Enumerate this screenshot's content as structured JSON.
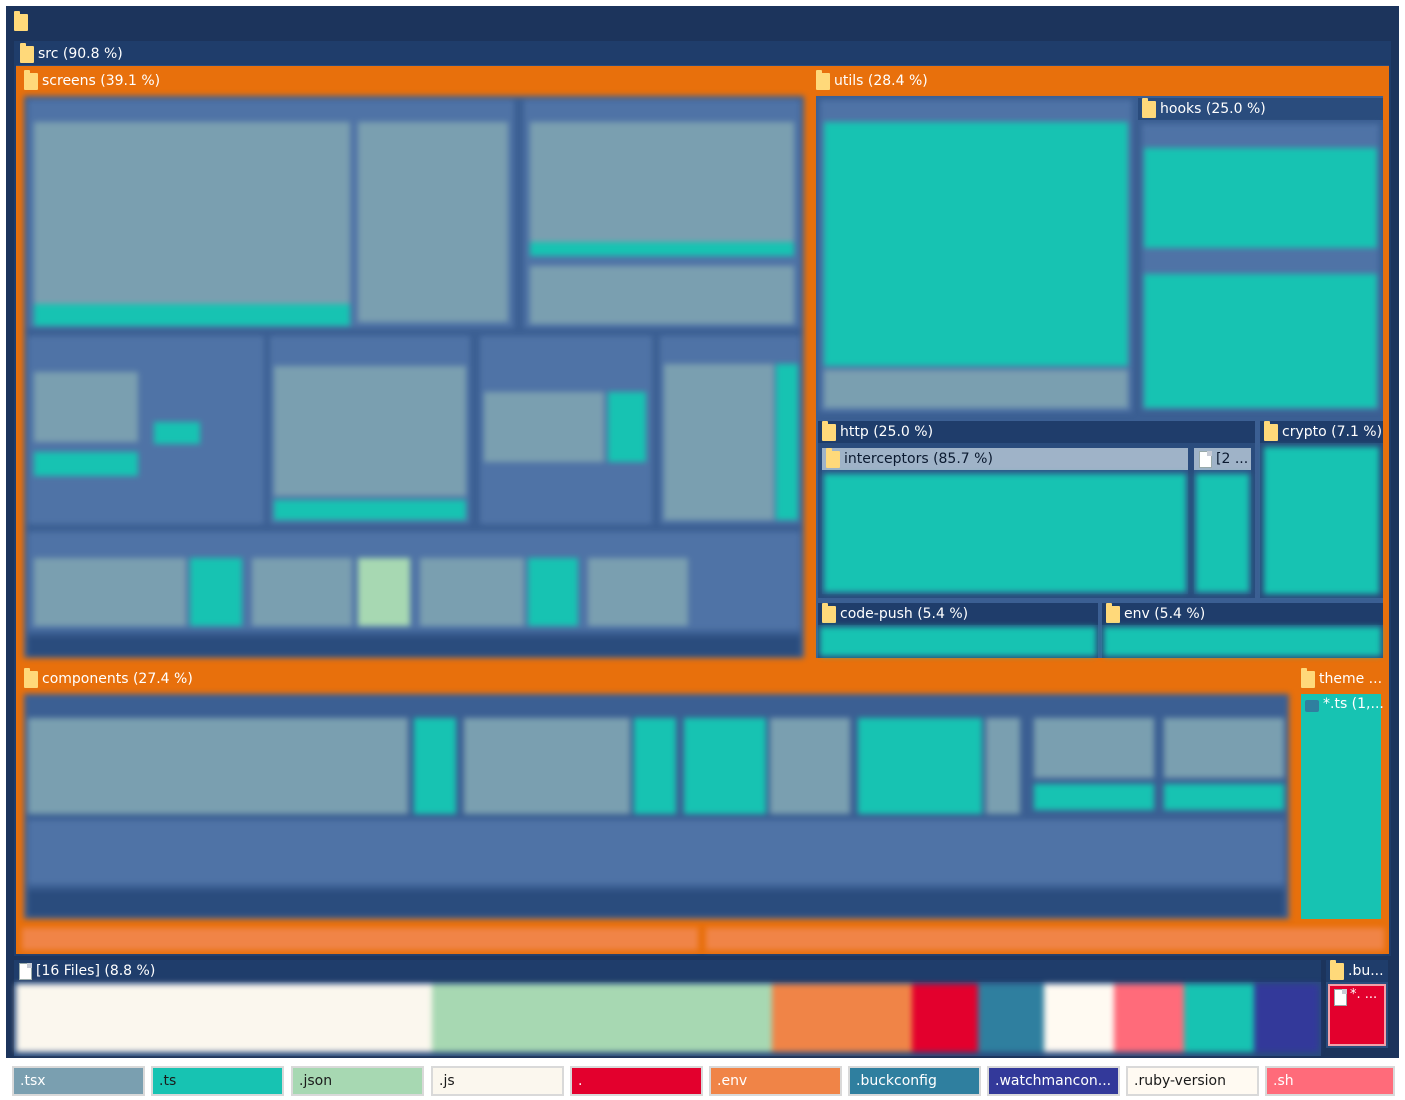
{
  "colors": {
    "root_bg": "#1c345c",
    "folder_bar": "#1f3d6b",
    "highlight": "#e8700c",
    "tsx": "#7a9fb0",
    "ts": "#17c3b2",
    "json": "#a7d8b2",
    "js": "#fbf7ee",
    "dot": "#e3002d",
    "env": "#f08447",
    "buckconfig": "#2f7f9f",
    "watchman": "#33399a",
    "ruby_version": "#fffaf2",
    "sh": "#ff6b7a"
  },
  "tree": {
    "root_icon": "folder-icon",
    "src": {
      "label": "src (90.8 %)"
    },
    "screens": {
      "label": "screens (39.1 %)"
    },
    "utils": {
      "label": "utils (28.4 %)"
    },
    "hooks": {
      "label": "hooks (25.0 %)"
    },
    "http": {
      "label": "http (25.0 %)"
    },
    "interceptors": {
      "label": "interceptors (85.7 %)"
    },
    "interceptors_sibling": {
      "label": "[2 ..."
    },
    "crypto": {
      "label": "crypto (7.1 %)"
    },
    "code_push": {
      "label": "code-push (5.4 %)"
    },
    "env": {
      "label": "env (5.4 %)"
    },
    "components": {
      "label": "components (27.4 %)"
    },
    "theme": {
      "label": "theme ...",
      "child": "*.ts (1,..."
    },
    "files16": {
      "label": "[16 Files] (8.8 %)"
    },
    "bu": {
      "label": ".bu...",
      "child": "*. ..."
    }
  },
  "legend": [
    {
      "label": ".tsx",
      "color": "#7a9fb0",
      "text": "dark"
    },
    {
      "label": ".ts",
      "color": "#17c3b2",
      "text": "light"
    },
    {
      "label": ".json",
      "color": "#a7d8b2",
      "text": "light"
    },
    {
      "label": ".js",
      "color": "#fbf7ee",
      "text": "light"
    },
    {
      "label": ".",
      "color": "#e3002d",
      "text": "dark"
    },
    {
      "label": ".env",
      "color": "#f08447",
      "text": "dark"
    },
    {
      "label": ".buckconfig",
      "color": "#2f7f9f",
      "text": "dark"
    },
    {
      "label": ".watchmancon...",
      "color": "#33399a",
      "text": "dark"
    },
    {
      "label": ".ruby-version",
      "color": "#fffaf2",
      "text": "light"
    },
    {
      "label": ".sh",
      "color": "#ff6b7a",
      "text": "dark"
    }
  ]
}
